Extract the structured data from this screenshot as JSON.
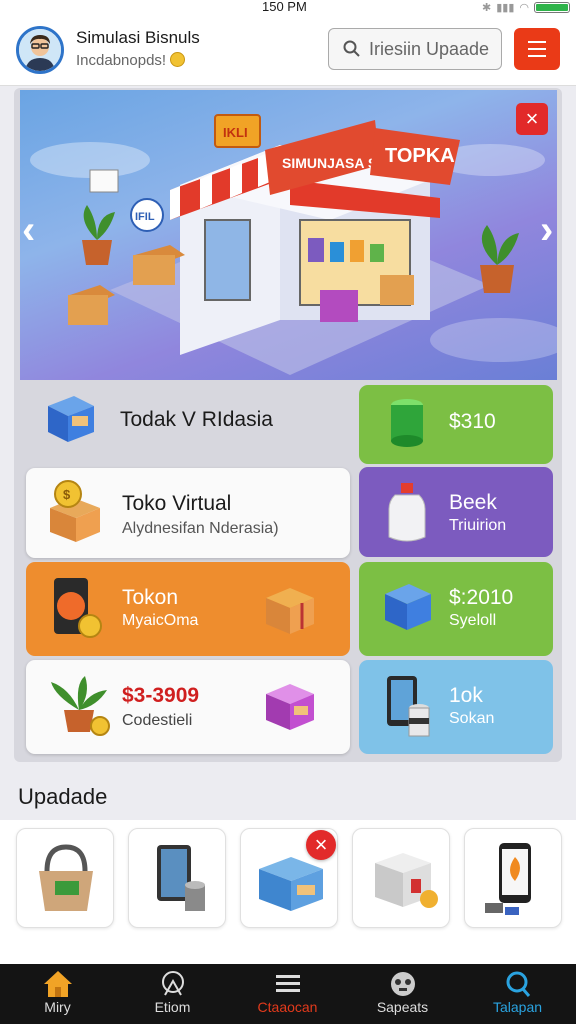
{
  "status": {
    "time": "150 PM"
  },
  "header": {
    "title": "Simulasi Bisnuls",
    "subtitle": "Incdabnopds!",
    "search_placeholder": "Iriesiin Upaade"
  },
  "hero": {
    "sign_left": "SIMUNJASA SINRDASIA",
    "sign_right": "TOPKA",
    "sign_top": "IKLI",
    "bubble": "IFIL"
  },
  "cards": {
    "c1": {
      "title": "Todak V RIdasia"
    },
    "c2": {
      "title": "$310"
    },
    "c3": {
      "title": "Toko Virtual",
      "sub": "Alydnesifan Nderasia)"
    },
    "c4": {
      "title": "Beek",
      "sub": "Triuirion"
    },
    "c5": {
      "title": "Tokon",
      "sub": "MyaicOma"
    },
    "c6": {
      "title": "$:2010",
      "sub": "Syeloll"
    },
    "c7": {
      "title": "$3-3909",
      "sub": "Codestieli"
    },
    "c8": {
      "title": "1ok",
      "sub": "Sokan"
    }
  },
  "section": {
    "title": "Upadade"
  },
  "nav": {
    "items": [
      {
        "label": "Miry",
        "icon": "home-icon",
        "color": "#f1a326"
      },
      {
        "label": "Etiom",
        "icon": "chart-icon",
        "color": "#dddddd"
      },
      {
        "label": "Ctaaocan",
        "icon": "menu-lines-icon",
        "color": "#e23a1c"
      },
      {
        "label": "Sapeats",
        "icon": "controller-icon",
        "color": "#dddddd"
      },
      {
        "label": "Talapan",
        "icon": "search-icon",
        "color": "#2aa3e0"
      }
    ]
  },
  "colors": {
    "accent": "#ea3a17",
    "green": "#7cbf44",
    "purple": "#7c5bbf",
    "orange": "#ee8d2e",
    "blue": "#7fc2e8"
  }
}
